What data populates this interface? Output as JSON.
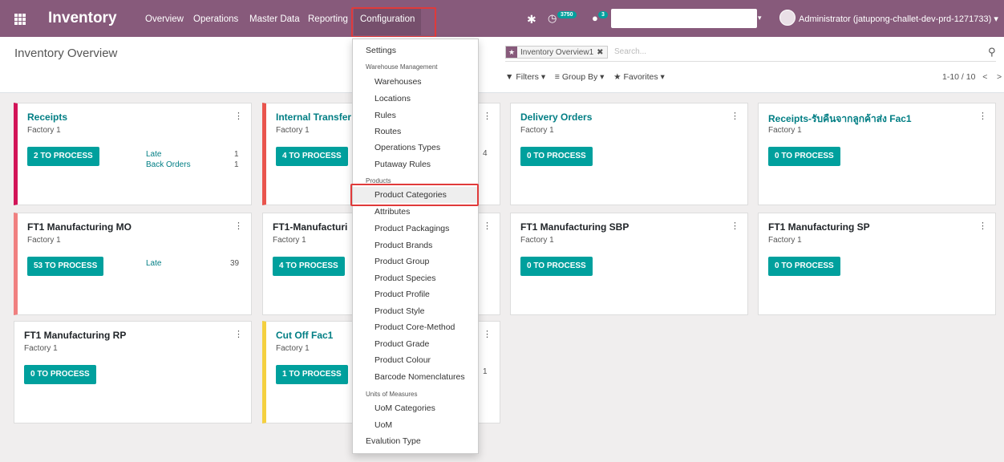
{
  "navbar": {
    "app_name": "Inventory",
    "menus": [
      "Overview",
      "Operations",
      "Master Data",
      "Reporting"
    ],
    "active_menu": "Configuration",
    "activity_count": "3750",
    "message_count": "3",
    "user_name": "Administrator (jatupong-challet-dev-prd-1271733)",
    "bug_icon": "bug-icon",
    "clock_icon": "clock-icon",
    "chat_icon": "chat-icon",
    "caret": "▾"
  },
  "control_panel": {
    "breadcrumb": "Inventory Overview",
    "facet_label": "Inventory Overview1",
    "search_placeholder": "Search...",
    "filters_label": "Filters",
    "groupby_label": "Group By",
    "favorites_label": "Favorites",
    "pager": "1-10 / 10"
  },
  "cards": [
    {
      "title": "Receipts",
      "subtitle": "Factory 1",
      "button": "2 TO PROCESS",
      "stats": [
        {
          "label": "Late",
          "value": "1"
        },
        {
          "label": "Back Orders",
          "value": "1"
        }
      ],
      "color": "#d21458"
    },
    {
      "title": "Internal Transfer",
      "subtitle": "Factory 1",
      "button": "4 TO PROCESS",
      "partial_value": "4",
      "color": "#e9544d"
    },
    {
      "title": "Delivery Orders",
      "subtitle": "Factory 1",
      "button": "0 TO PROCESS"
    },
    {
      "title": "Receipts-รับคืนจากลูกค้าส่ง Fac1",
      "subtitle": "Factory 1",
      "button": "0 TO PROCESS"
    },
    {
      "title": "FT1 Manufacturing MO",
      "subtitle": "Factory 1",
      "button": "53 TO PROCESS",
      "stats": [
        {
          "label": "Late",
          "value": "39"
        }
      ],
      "color": "#f08080"
    },
    {
      "title": "FT1-Manufacturi",
      "subtitle": "Factory 1",
      "button": "4 TO PROCESS"
    },
    {
      "title": "FT1 Manufacturing SBP",
      "subtitle": "Factory 1",
      "button": "0 TO PROCESS"
    },
    {
      "title": "FT1 Manufacturing SP",
      "subtitle": "Factory 1",
      "button": "0 TO PROCESS"
    },
    {
      "title": "FT1 Manufacturing RP",
      "subtitle": "Factory 1",
      "button": "0 TO PROCESS"
    },
    {
      "title": "Cut Off Fac1",
      "subtitle": "Factory 1",
      "button": "1 TO PROCESS",
      "partial_value": "1",
      "color": "#f4d03f"
    }
  ],
  "dropdown": {
    "items": [
      {
        "type": "item",
        "label": "Settings"
      },
      {
        "type": "header",
        "label": "Warehouse Management"
      },
      {
        "type": "item",
        "label": "Warehouses"
      },
      {
        "type": "item",
        "label": "Locations"
      },
      {
        "type": "item",
        "label": "Rules"
      },
      {
        "type": "item",
        "label": "Routes"
      },
      {
        "type": "item",
        "label": "Operations Types"
      },
      {
        "type": "item",
        "label": "Putaway Rules"
      },
      {
        "type": "header",
        "label": "Products"
      },
      {
        "type": "item",
        "label": "Product Categories",
        "highlighted": true
      },
      {
        "type": "item",
        "label": "Attributes"
      },
      {
        "type": "item",
        "label": "Product Packagings"
      },
      {
        "type": "item",
        "label": "Product Brands"
      },
      {
        "type": "item",
        "label": "Product Group"
      },
      {
        "type": "item",
        "label": "Product Species"
      },
      {
        "type": "item",
        "label": "Product Profile"
      },
      {
        "type": "item",
        "label": "Product Style"
      },
      {
        "type": "item",
        "label": "Product Core-Method"
      },
      {
        "type": "item",
        "label": "Product Grade"
      },
      {
        "type": "item",
        "label": "Product Colour"
      },
      {
        "type": "item",
        "label": "Barcode Nomenclatures"
      },
      {
        "type": "header",
        "label": "Units of Measures"
      },
      {
        "type": "item",
        "label": "UoM Categories"
      },
      {
        "type": "item",
        "label": "UoM"
      },
      {
        "type": "item",
        "label": "Evalution Type"
      }
    ]
  },
  "colors": {
    "brand": "#875a7b",
    "accent": "#00a09d",
    "highlight": "#e03a3a"
  }
}
